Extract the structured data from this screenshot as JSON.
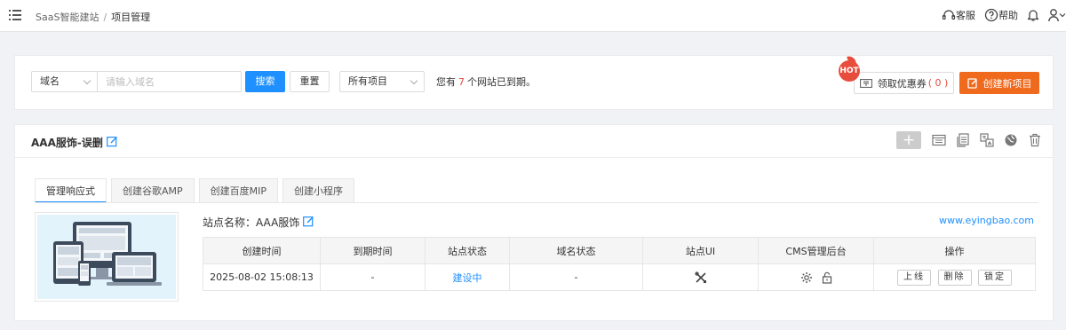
{
  "topbar": {
    "breadcrumb": {
      "root": "SaaS智能建站",
      "separator": "/",
      "current": "项目管理"
    },
    "service_label": "客服",
    "help_label": "帮助"
  },
  "search": {
    "domain_select": "域名",
    "input_placeholder": "请输入域名",
    "search_button": "搜索",
    "reset_button": "重置",
    "project_select": "所有项目",
    "expire_prefix": "您有",
    "expire_count": "7",
    "expire_suffix": "个网站已到期。",
    "hot_badge": "HOT",
    "coupon_label": "领取优惠券",
    "coupon_count": "( 0 )",
    "create_button": "创建新项目"
  },
  "project": {
    "title": "AAA服饰-误删",
    "tabs": [
      {
        "label": "管理响应式",
        "active": true
      },
      {
        "label": "创建谷歌AMP",
        "active": false
      },
      {
        "label": "创建百度MIP",
        "active": false
      },
      {
        "label": "创建小程序",
        "active": false
      }
    ],
    "site_name": "站点名称：AAA服饰",
    "site_url": "www.eyingbao.com",
    "table": {
      "headers": [
        "创建时间",
        "到期时间",
        "站点状态",
        "域名状态",
        "站点UI",
        "CMS管理后台",
        "操作"
      ],
      "row": {
        "created": "2025-08-02 15:08:13",
        "expires": "-",
        "status": "建设中",
        "domain_status": "-"
      },
      "actions": [
        "上线",
        "删除",
        "锁定"
      ]
    }
  },
  "colors": {
    "primary": "#1e90ff",
    "accent": "#f06a1d",
    "danger": "#e74c3c"
  }
}
